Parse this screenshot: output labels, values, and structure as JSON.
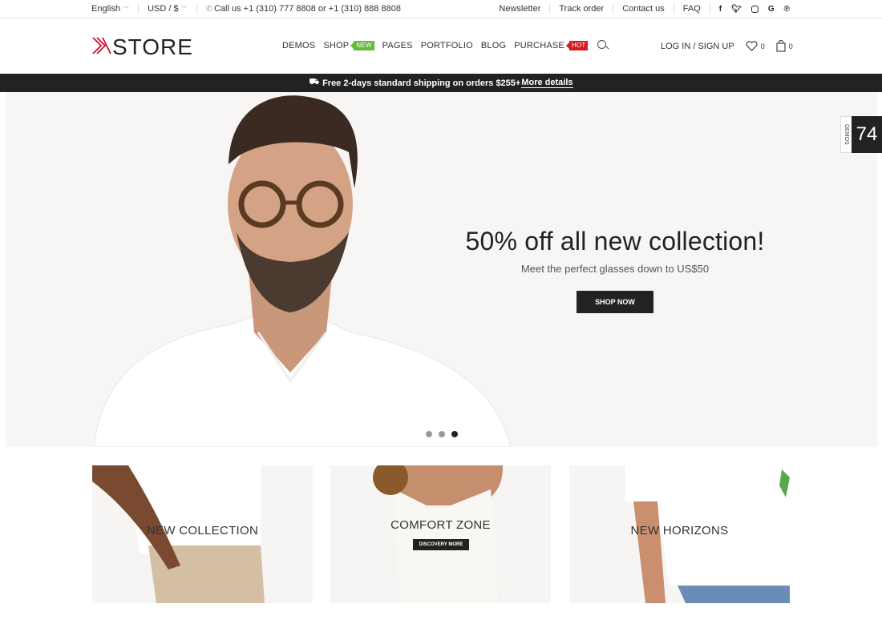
{
  "topbar": {
    "language": "English",
    "currency": "USD / $",
    "phone": "Call us +1 (310) 777 8808 or +1 (310) 888 8808",
    "links": [
      "Newsletter",
      "Track order",
      "Contact us",
      "FAQ"
    ],
    "social": [
      "f",
      "t",
      "ig",
      "G",
      "p"
    ]
  },
  "header": {
    "logo_mark": "X",
    "logo_text": "STORE",
    "nav": [
      {
        "label": "DEMOS"
      },
      {
        "label": "SHOP",
        "badge": "NEW"
      },
      {
        "label": "PAGES"
      },
      {
        "label": "PORTFOLIO"
      },
      {
        "label": "BLOG"
      },
      {
        "label": "PURCHASE",
        "badge": "HOT"
      }
    ],
    "login_label": "LOG IN / SIGN UP",
    "wishlist_count": "0",
    "cart_count": "0"
  },
  "promo": {
    "text": "Free 2-days standard shipping on orders $255+",
    "link": "More details"
  },
  "hero": {
    "title": "50% off all new collection!",
    "subtitle": "Meet the perfect glasses down to US$50",
    "button": "SHOP NOW",
    "slide_count": 3,
    "active_slide": 3
  },
  "demos_tab": {
    "label": "DEMOS",
    "count": "74"
  },
  "banners": [
    {
      "title": "NEW COLLECTION"
    },
    {
      "title": "COMFORT ZONE",
      "button": "DISCOVERY MORE"
    },
    {
      "title": "NEW HORIZONS"
    }
  ],
  "colors": {
    "brand_red": "#c8102e",
    "new_badge": "#66b93b",
    "hot_badge": "#d71920",
    "dark": "#222222"
  }
}
